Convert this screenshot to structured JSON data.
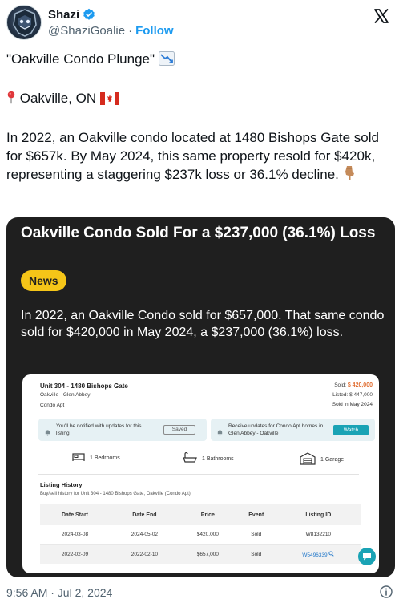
{
  "author": {
    "display_name": "Shazi",
    "handle": "@ShaziGoalie",
    "separator": "·",
    "follow_label": "Follow"
  },
  "tweet": {
    "line_title": "\"Oakville Condo Plunge\"",
    "line_location": "Oakville, ON",
    "body": "In 2022, an Oakville condo located at 1480 Bishops Gate sold for $657k. By May 2024, this same property resold for $420k, representing a staggering $237k loss or 36.1% decline.",
    "timestamp": "9:56 AM · Jul 2, 2024"
  },
  "card": {
    "title": "Oakville Condo Sold For a $237,000 (36.1%) Loss",
    "badge": "News",
    "body": "In 2022, an Oakville Condo sold for $657,000. That same condo sold for $420,000 in May 2024, a $237,000 (36.1%) loss."
  },
  "listing": {
    "unit": "Unit 304 - 1480 Bishops Gate",
    "area": "Oakville - Glen Abbey",
    "type": "Condo Apt",
    "sold_label": "Sold:",
    "sold_price": "$ 420,000",
    "listed_label": "Listed:",
    "listed_price": "$ 447,000",
    "sold_date": "Sold in May 2024",
    "notify_text": "You'll be notified with updates for this listing",
    "saved_label": "Saved",
    "receive_text": "Receive updates for Condo Apt homes in Glen Abbey - Oakville",
    "watch_label": "Watch",
    "bedrooms": "1 Bedrooms",
    "bathrooms": "1 Bathrooms",
    "garage": "1 Garage",
    "history_title": "Listing History",
    "history_sub": "Buy/sell history for Unit 304 - 1480 Bishops Gate, Oakville (Condo Apt)",
    "columns": [
      "Date Start",
      "Date End",
      "Price",
      "Event",
      "Listing ID"
    ],
    "rows": [
      [
        "2024-03-08",
        "2024-05-02",
        "$420,000",
        "Sold",
        "W8132210"
      ],
      [
        "2022-02-09",
        "2022-02-10",
        "$657,000",
        "Sold",
        "W5496339"
      ]
    ]
  },
  "colors": {
    "follow": "#1d9bf0",
    "card_bg": "#1f1f1f",
    "badge": "#f5c518",
    "sold_price": "#e06a2c",
    "watch": "#1aa3b5"
  },
  "icons": [
    "verified-badge-icon",
    "x-logo-icon",
    "chart-decreasing-icon",
    "round-pushpin-icon",
    "canada-flag-icon",
    "point-down-icon",
    "bell-icon",
    "bed-icon",
    "bath-icon",
    "garage-icon",
    "search-icon",
    "chat-icon",
    "info-icon"
  ]
}
